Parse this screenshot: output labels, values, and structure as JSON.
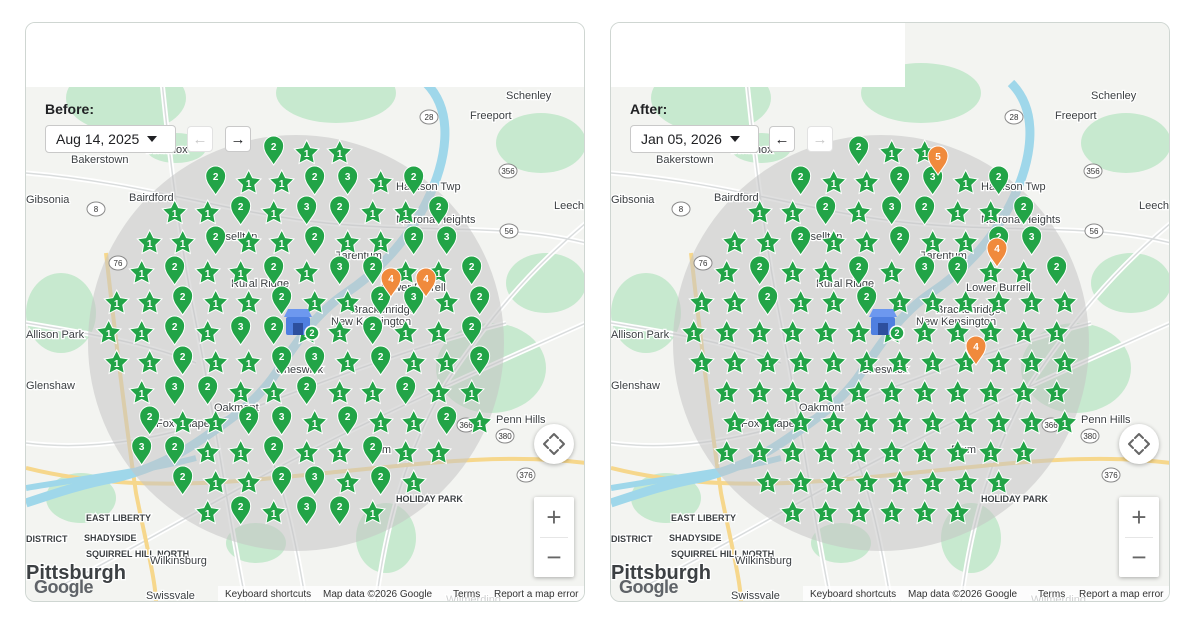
{
  "panels": [
    {
      "id": "before",
      "label": "Before:",
      "date": "Aug 14, 2025",
      "prev_enabled": false,
      "next_enabled": true,
      "orange_pins": [
        {
          "label": "4"
        },
        {
          "label": "4"
        }
      ],
      "counts": {
        "1": 80,
        "2": 48,
        "3": 13,
        "4": 2
      }
    },
    {
      "id": "after",
      "label": "After:",
      "date": "Jan 05, 2026",
      "prev_enabled": true,
      "next_enabled": false,
      "orange_pins": [
        {
          "label": "5"
        },
        {
          "label": "4"
        },
        {
          "label": "4"
        }
      ],
      "counts": {
        "1": 112,
        "2": 16,
        "3": 4,
        "4": 2,
        "5": 1
      }
    }
  ],
  "map_labels": {
    "places": [
      "Schenley",
      "Freeport",
      "Bakerstown",
      "Harrison Twp",
      "Gibsonia",
      "Bairdford",
      "Natrona Heights",
      "Russellton",
      "Tarentum",
      "Rural Ridge",
      "Brackenridge",
      "Lower Burrell",
      "Allison Park",
      "New Kensington",
      "Glenshaw",
      "Cheswick",
      "Oakmont",
      "Fox Chapel",
      "Plum",
      "Leechburg",
      "HOLIDAY PARK",
      "EAST LIBERTY",
      "DISTRICT",
      "SHADYSIDE",
      "SQUIRREL HILL NORTH",
      "Wilkinsburg",
      "Pittsburgh",
      "Swissvale",
      "Wilmerding",
      "Blawnox",
      "Penn Hills"
    ],
    "shields": [
      "28",
      "356",
      "8",
      "56",
      "76",
      "380",
      "366",
      "376"
    ]
  },
  "attribution": {
    "keyboard": "Keyboard shortcuts",
    "map_data": "Map data ©2026 Google",
    "terms": "Terms",
    "report": "Report a map error"
  },
  "logo": "Google",
  "icons": {
    "compass": "pan-control-icon",
    "zoom_in": "+",
    "zoom_out": "−",
    "prev": "←",
    "next": "→",
    "caret": "chevron-down-icon",
    "store": "store-icon"
  },
  "colors": {
    "pin_green": "#22a447",
    "pin_orange": "#f08a3c",
    "radius_fill": "#c5c5c5",
    "water": "#9fd7ea",
    "park": "#b8e6c3",
    "store_blue": "#4f7fe0"
  }
}
